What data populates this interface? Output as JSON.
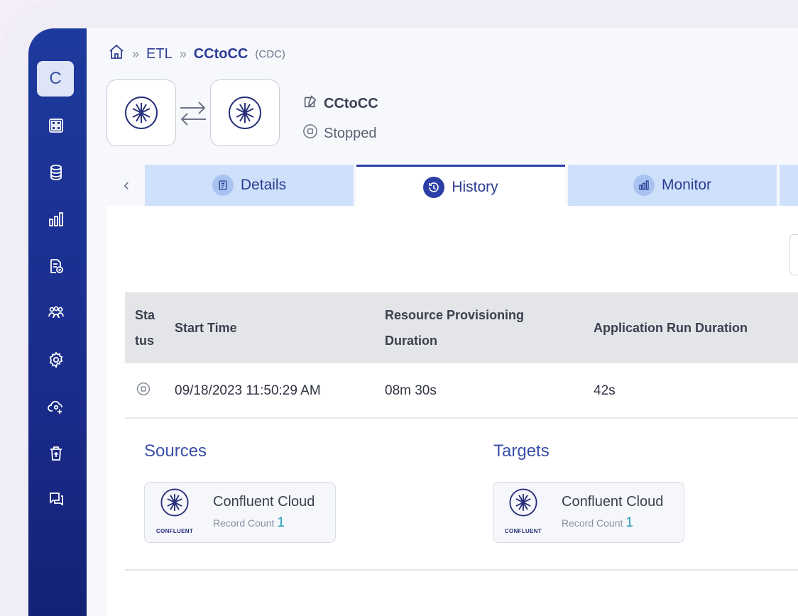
{
  "sidebar": {
    "avatar_letter": "C",
    "items": [
      {
        "icon": "dashboard-grid-icon"
      },
      {
        "icon": "database-icon"
      },
      {
        "icon": "bar-chart-icon"
      },
      {
        "icon": "document-check-icon"
      },
      {
        "icon": "users-group-icon"
      },
      {
        "icon": "settings-gear-icon"
      },
      {
        "icon": "cloud-user-icon"
      },
      {
        "icon": "trash-icon"
      },
      {
        "icon": "chat-bubbles-icon"
      }
    ]
  },
  "breadcrumb": {
    "home_icon": "home-icon",
    "separator": "»",
    "section": "ETL",
    "current": "CCtoCC",
    "current_tag": "(CDC)"
  },
  "pipeline": {
    "name": "CCtoCC",
    "status": "Stopped"
  },
  "tabs": [
    {
      "label": "Details",
      "icon": "document-icon",
      "active": false
    },
    {
      "label": "History",
      "icon": "history-clock-icon",
      "active": true
    },
    {
      "label": "Monitor",
      "icon": "bar-chart-icon",
      "active": false
    }
  ],
  "history_table": {
    "headers": {
      "status_line1": "Sta",
      "status_line2": "tus",
      "start_time": "Start Time",
      "provisioning_line1": "Resource Provisioning",
      "provisioning_line2": "Duration",
      "run_duration": "Application Run Duration"
    },
    "rows": [
      {
        "status_icon": "stopped-icon",
        "start_time": "09/18/2023 11:50:29 AM",
        "provisioning": "08m 30s",
        "run_duration": "42s"
      }
    ]
  },
  "sources": {
    "title": "Sources",
    "card": {
      "name": "Confluent Cloud",
      "record_label": "Record Count",
      "record_count": "1",
      "logo_text": "CONFLUENT"
    }
  },
  "targets": {
    "title": "Targets",
    "card": {
      "name": "Confluent Cloud",
      "record_label": "Record Count",
      "record_count": "1",
      "logo_text": "CONFLUENT"
    }
  },
  "colors": {
    "sidebar": "#1d3a9e",
    "accent": "#2b3fa6",
    "tab_inactive": "#cfe0fb",
    "record_count": "#1d9bb8"
  }
}
